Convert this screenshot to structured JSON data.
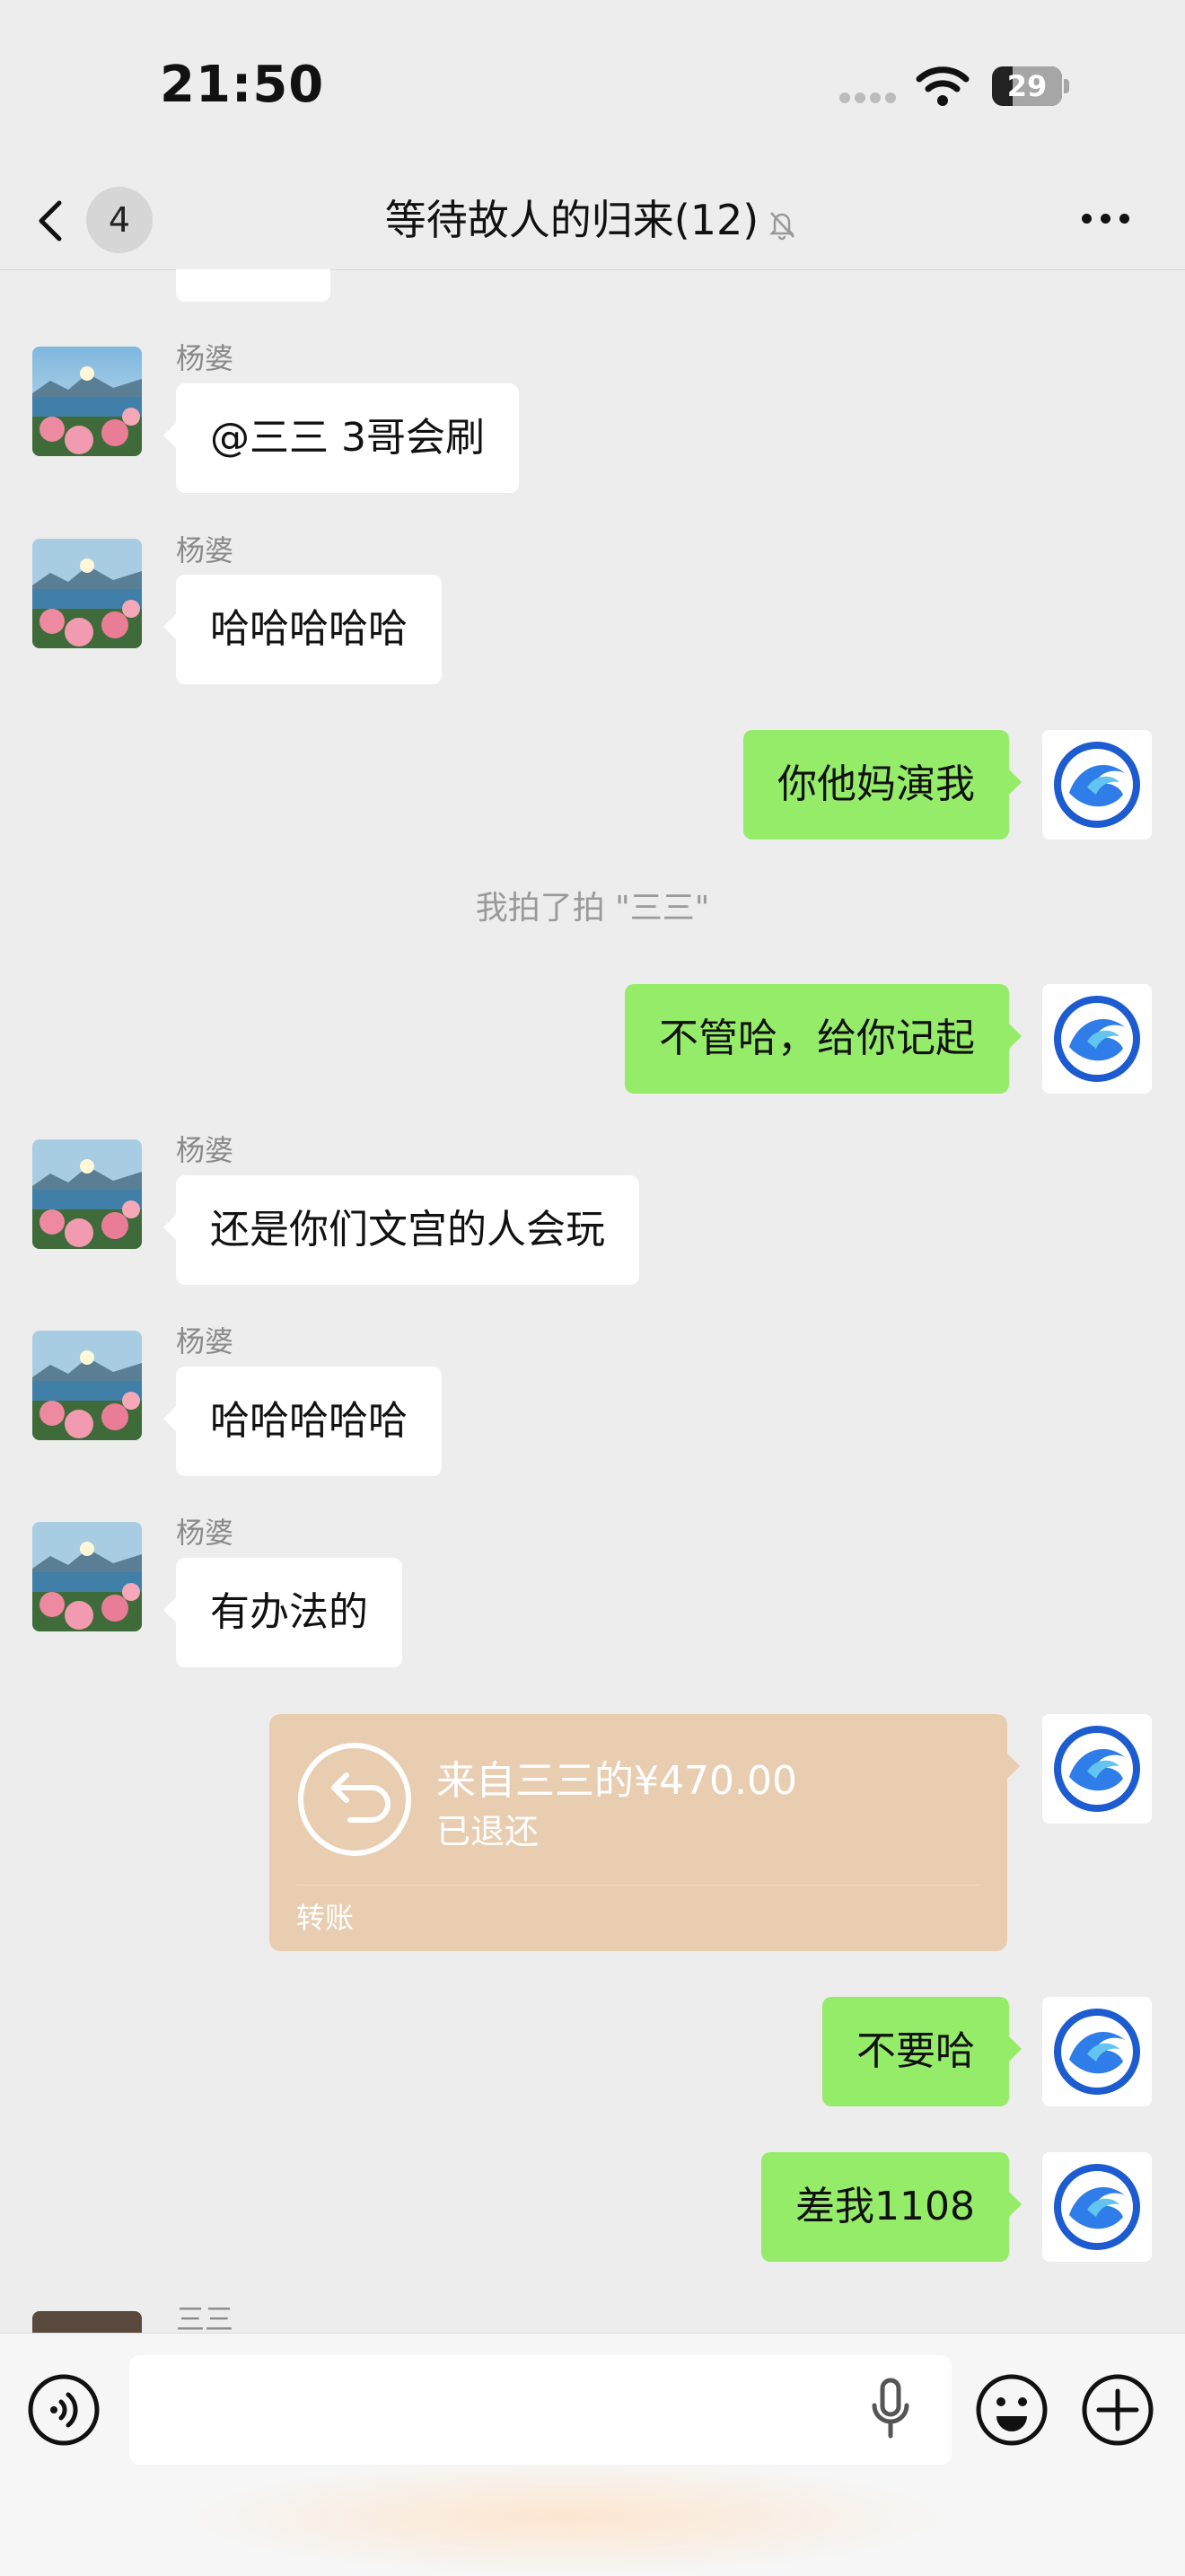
{
  "status_bar": {
    "time": "21:50",
    "battery": "29",
    "battery_level": 0.29
  },
  "nav": {
    "back_badge": "4",
    "title": "等待故人的归来(12)"
  },
  "messages": {
    "m1": {
      "sender": "杨婆",
      "text": "@三三 3哥会刷"
    },
    "m2": {
      "sender": "杨婆",
      "text": "哈哈哈哈哈"
    },
    "m3": {
      "text": "你他妈演我"
    },
    "sys1": {
      "text": "我拍了拍 \"三三\""
    },
    "m4": {
      "text": "不管哈，给你记起"
    },
    "m5": {
      "sender": "杨婆",
      "text": "还是你们文宫的人会玩"
    },
    "m6": {
      "sender": "杨婆",
      "text": "哈哈哈哈哈"
    },
    "m7": {
      "sender": "杨婆",
      "text": "有办法的"
    },
    "transfer": {
      "title": "来自三三的¥470.00",
      "status": "已退还",
      "label": "转账"
    },
    "m8": {
      "text": "不要哈"
    },
    "m9": {
      "text": "差我1108"
    },
    "m10": {
      "sender": "三三"
    }
  },
  "input": {
    "placeholder": ""
  },
  "colors": {
    "self_bubble": "#95ec69",
    "other_bubble": "#ffffff",
    "transfer_card": "#e9cdb1",
    "background": "#ededed"
  }
}
